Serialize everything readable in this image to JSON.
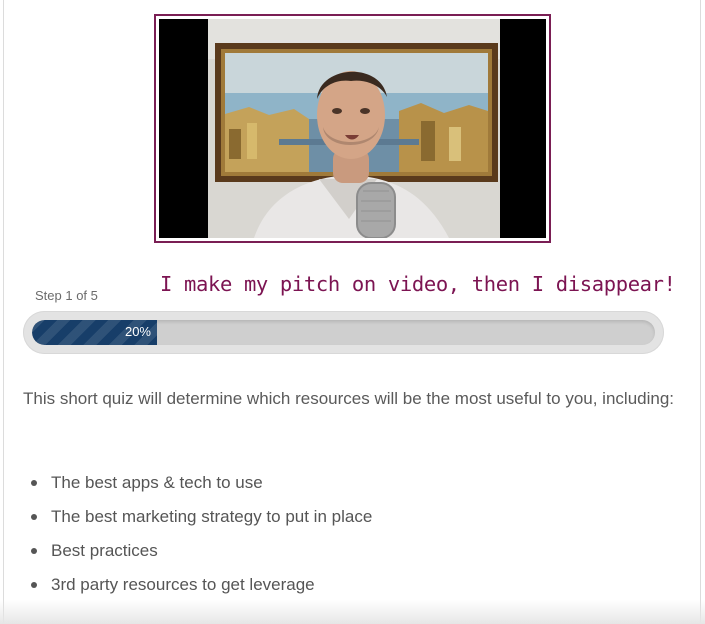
{
  "video": {
    "border_color": "#7a1e54",
    "content": "presenter-speaking-into-microphone"
  },
  "caption": {
    "text": "I make my pitch on video, then I disappear!",
    "color": "#7c1452"
  },
  "progress": {
    "step_label": "Step 1 of 5",
    "percent_label": "20%",
    "fraction": 0.2,
    "fill_color": "#173e69"
  },
  "content": {
    "intro": "This short quiz will determine which resources will be the most useful to you, including:",
    "bullets": [
      "The best apps & tech to use",
      "The best marketing strategy to put in place",
      "Best practices",
      "3rd party resources to get leverage"
    ]
  }
}
